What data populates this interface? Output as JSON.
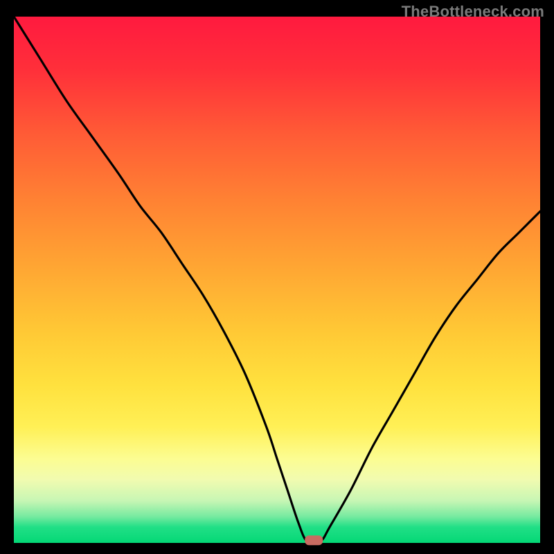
{
  "watermark": "TheBottleneck.com",
  "chart_data": {
    "type": "line",
    "title": "",
    "xlabel": "",
    "ylabel": "",
    "xlim": [
      0,
      100
    ],
    "ylim": [
      0,
      100
    ],
    "grid": false,
    "legend": false,
    "background": "vertical-gradient red→orange→yellow→green",
    "series": [
      {
        "name": "bottleneck-curve",
        "x": [
          0,
          5,
          10,
          15,
          20,
          24,
          28,
          32,
          36,
          40,
          44,
          48,
          50,
          52,
          54,
          55.5,
          57,
          58.5,
          60,
          64,
          68,
          72,
          76,
          80,
          84,
          88,
          92,
          96,
          100
        ],
        "values": [
          100,
          92,
          84,
          77,
          70,
          64,
          59,
          53,
          47,
          40,
          32,
          22,
          16,
          10,
          4,
          0.5,
          0.5,
          0.5,
          3,
          10,
          18,
          25,
          32,
          39,
          45,
          50,
          55,
          59,
          63
        ]
      }
    ],
    "annotations": [
      {
        "name": "valley-minimum-marker",
        "x": 57,
        "y": 0.5,
        "shape": "rounded-rect",
        "color": "#c96b61"
      }
    ]
  },
  "colors": {
    "curve": "#000000",
    "frame": "#000000",
    "marker": "#c96b61"
  }
}
